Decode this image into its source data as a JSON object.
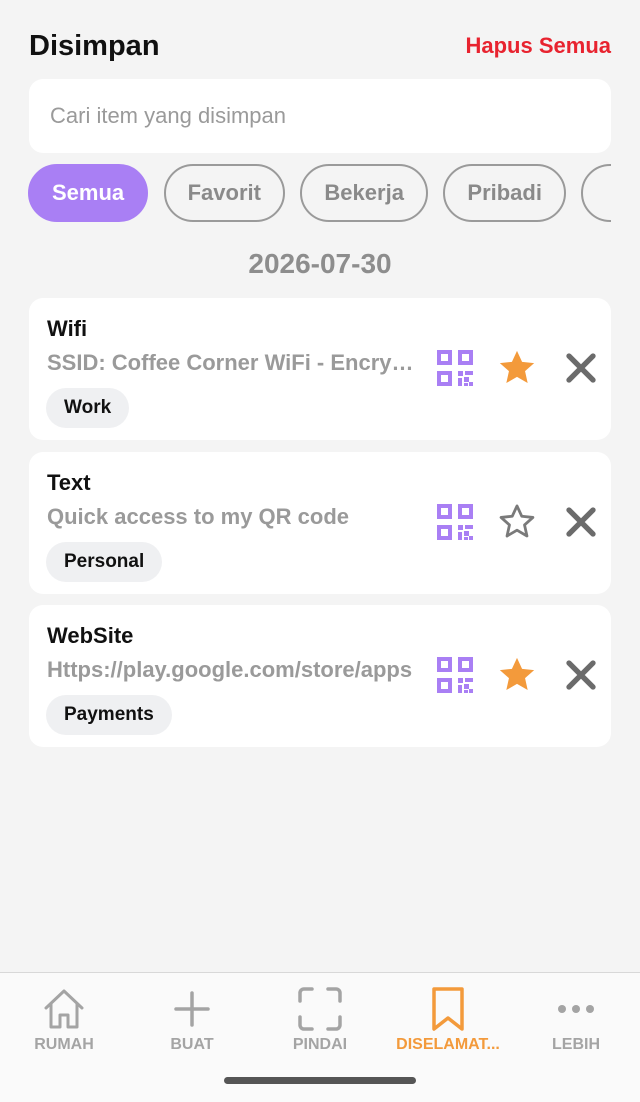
{
  "header": {
    "title": "Disimpan",
    "clear_all": "Hapus Semua"
  },
  "search": {
    "placeholder": "Cari item yang disimpan",
    "value": ""
  },
  "filters": [
    {
      "label": "Semua",
      "active": true
    },
    {
      "label": "Favorit",
      "active": false
    },
    {
      "label": "Bekerja",
      "active": false
    },
    {
      "label": "Pribadi",
      "active": false
    },
    {
      "label": "",
      "active": false
    }
  ],
  "date": "2026-07-30",
  "items": [
    {
      "type": "Wifi",
      "content": "SSID: Coffee Corner WiFi - Encryption: WPA",
      "tag": "Work",
      "favorite": true
    },
    {
      "type": "Text",
      "content": "Quick access to my QR code",
      "tag": "Personal",
      "favorite": false
    },
    {
      "type": "WebSite",
      "content": "Https://play.google.com/store/apps",
      "tag": "Payments",
      "favorite": true
    }
  ],
  "tabbar": [
    {
      "label": "RUMAH",
      "icon": "home-icon",
      "active": false
    },
    {
      "label": "BUAT",
      "icon": "plus-icon",
      "active": false
    },
    {
      "label": "PINDAI",
      "icon": "scan-icon",
      "active": false
    },
    {
      "label": "DISELAMAT...",
      "icon": "bookmark-icon",
      "active": true
    },
    {
      "label": "LEBIH",
      "icon": "more-icon",
      "active": false
    }
  ],
  "colors": {
    "accent": "#a97ff4",
    "favorite": "#f39a3b",
    "danger": "#e8232f",
    "active_tab": "#f39a3b"
  }
}
